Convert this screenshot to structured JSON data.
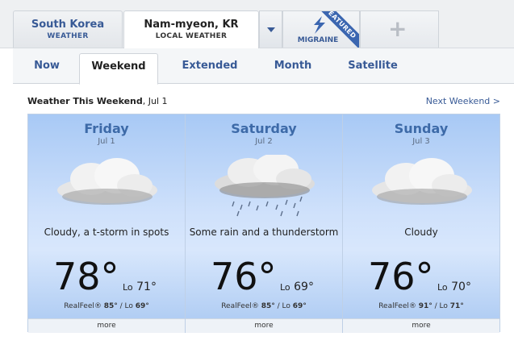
{
  "locations": {
    "country": {
      "name": "South Korea",
      "sub": "WEATHER"
    },
    "current": {
      "name": "Nam-myeon, KR",
      "sub": "LOCAL WEATHER"
    },
    "migraine": {
      "label": "MIGRAINE",
      "ribbon": "FEATURED"
    },
    "add_symbol": "+"
  },
  "tabs": [
    "Now",
    "Weekend",
    "Extended",
    "Month",
    "Satellite"
  ],
  "active_tab": "Weekend",
  "section": {
    "title": "Weather This Weekend",
    "date": ", Jul 1",
    "next_link": "Next Weekend >"
  },
  "days": [
    {
      "name": "Friday",
      "date": "Jul 1",
      "condition": "Cloudy, a t-storm in spots",
      "high": "78°",
      "lo_label": "Lo",
      "low": "71°",
      "realfeel_label": "RealFeel®",
      "realfeel_high": "85°",
      "realfeel_sep": " / Lo ",
      "realfeel_low": "69°",
      "more": "more",
      "icon": "cloudy-icon"
    },
    {
      "name": "Saturday",
      "date": "Jul 2",
      "condition": "Some rain and a thunderstorm",
      "high": "76°",
      "lo_label": "Lo",
      "low": "69°",
      "realfeel_label": "RealFeel®",
      "realfeel_high": "85°",
      "realfeel_sep": " / Lo ",
      "realfeel_low": "69°",
      "more": "more",
      "icon": "rain-cloud-icon"
    },
    {
      "name": "Sunday",
      "date": "Jul 3",
      "condition": "Cloudy",
      "high": "76°",
      "lo_label": "Lo",
      "low": "70°",
      "realfeel_label": "RealFeel®",
      "realfeel_high": "91°",
      "realfeel_sep": " / Lo ",
      "realfeel_low": "71°",
      "more": "more",
      "icon": "cloudy-icon"
    }
  ],
  "colors": {
    "link": "#385a96",
    "day_heading": "#3d6aa8",
    "panel_top": "#a8c9f5",
    "panel_mid": "#d8e7fc"
  }
}
